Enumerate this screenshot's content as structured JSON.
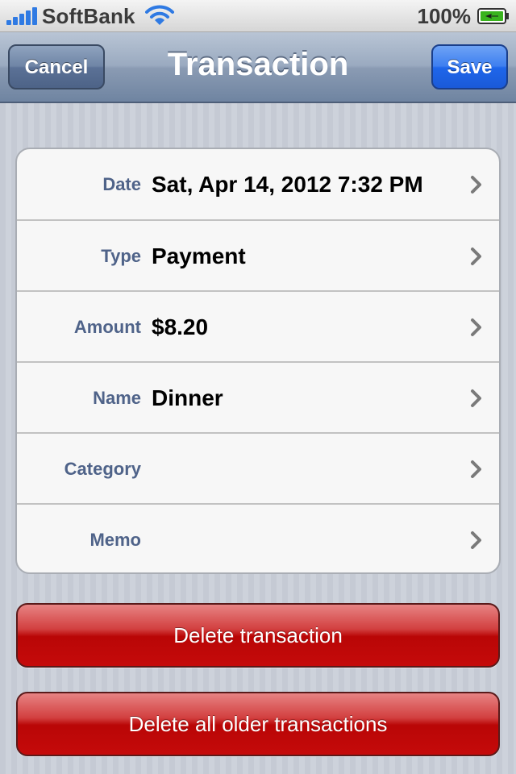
{
  "status_bar": {
    "carrier": "SoftBank",
    "battery": "100%",
    "icons": [
      "signal-icon",
      "wifi-icon",
      "battery-charging-icon"
    ]
  },
  "nav": {
    "title": "Transaction",
    "cancel_label": "Cancel",
    "save_label": "Save"
  },
  "fields": [
    {
      "label": "Date",
      "value": "Sat, Apr 14, 2012 7:32 PM"
    },
    {
      "label": "Type",
      "value": "Payment"
    },
    {
      "label": "Amount",
      "value": "$8.20"
    },
    {
      "label": "Name",
      "value": "Dinner"
    },
    {
      "label": "Category",
      "value": ""
    },
    {
      "label": "Memo",
      "value": ""
    }
  ],
  "actions": {
    "delete_label": "Delete transaction",
    "delete_older_label": "Delete all older transactions"
  },
  "colors": {
    "nav_bar": "#8a9bb3",
    "save_button": "#1f66ea",
    "label_text": "#4f6389",
    "delete_button": "#b90606",
    "signal": "#2f7ae3"
  }
}
